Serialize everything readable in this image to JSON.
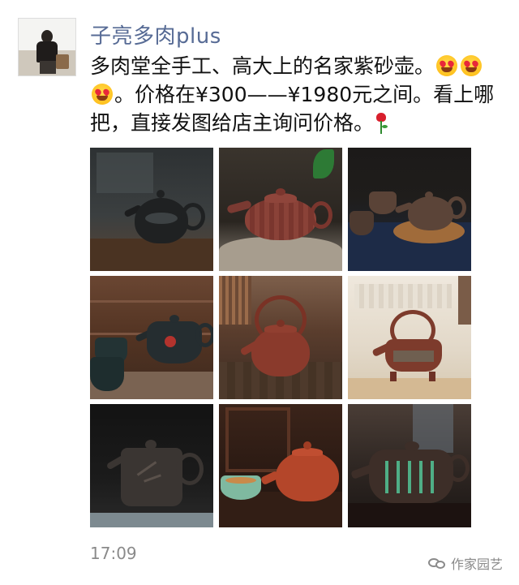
{
  "post": {
    "author_name": "子亮多肉plus",
    "text_part1": "多肉堂全手工、高大上的名家紫砂壶。",
    "text_part2": "。价格在¥300——¥1980元之间。看上哪把，直接发图给店主询问价格。",
    "emoji_icon": "heart-eyes-emoji-icon",
    "rose_icon": "rose-icon",
    "timestamp": "17:09"
  },
  "gallery": {
    "photos": [
      {
        "subject": "black teapot with dragon relief on wooden stand"
      },
      {
        "subject": "red woven-pattern teapot on stone"
      },
      {
        "subject": "brown teapot set with cups on mat"
      },
      {
        "subject": "dark teapot with red flower and two cups"
      },
      {
        "subject": "red teapot with tall loop handle"
      },
      {
        "subject": "loop-handle teapot with inscription on tripod"
      },
      {
        "subject": "dark square teapot with bamboo carving"
      },
      {
        "subject": "orange-red teapot with celadon cup"
      },
      {
        "subject": "dark teapot with green calligraphy"
      }
    ]
  },
  "watermark": {
    "text": "作家园艺",
    "icon": "chat-bubbles-icon"
  }
}
